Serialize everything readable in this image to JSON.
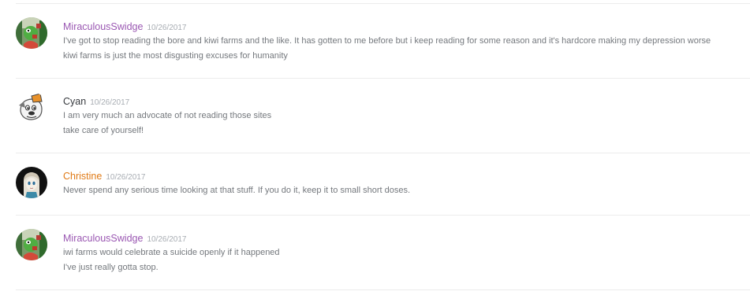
{
  "colors": {
    "username_purple": "#9a57b2",
    "username_dark": "#36393e",
    "username_orange": "#e07a16",
    "body_text": "#74787d",
    "timestamp": "#a8adb3",
    "divider": "#ececec"
  },
  "messages": [
    {
      "author": "MiraculousSwidge",
      "avatar_icon": "green-character-avatar-icon",
      "timestamp": "10/26/2017",
      "lines": [
        "I've got to stop reading the bore and kiwi farms and the like. It has gotten to me before but i keep reading  for some reason and it's hardcore making my depression worse",
        "kiwi farms is just the most disgusting excuses for humanity"
      ]
    },
    {
      "author": "Cyan",
      "avatar_icon": "cartoon-dog-avatar-icon",
      "timestamp": "10/26/2017",
      "lines": [
        "I am very much an advocate of not reading those sites",
        "take care of yourself!"
      ]
    },
    {
      "author": "Christine",
      "avatar_icon": "anime-girl-avatar-icon",
      "timestamp": "10/26/2017",
      "lines": [
        "Never spend any serious time looking at that stuff. If you do it, keep it to small short doses."
      ]
    },
    {
      "author": "MiraculousSwidge",
      "avatar_icon": "green-character-avatar-icon",
      "timestamp": "10/26/2017",
      "lines": [
        "iwi farms would celebrate a suicide openly if it happened",
        "I've just really gotta stop."
      ]
    }
  ]
}
